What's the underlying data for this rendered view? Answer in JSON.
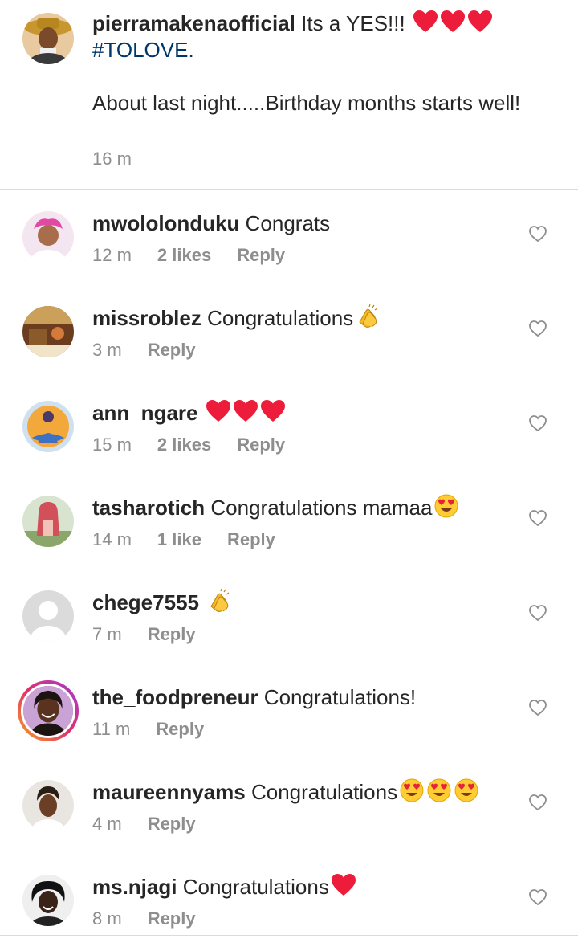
{
  "caption": {
    "username": "pierramakenaofficial",
    "text": "Its  a YES!!!",
    "emojis": [
      "red-heart-icon",
      "red-heart-icon",
      "red-heart-icon"
    ],
    "hashtag": "#TOLOVE.",
    "text2": "About last night.....Birthday months starts well!",
    "time": "16 m"
  },
  "comments": [
    {
      "username": "mwololonduku",
      "text": "Congrats",
      "emojis": [],
      "time": "12 m",
      "likes": "2 likes",
      "reply": "Reply"
    },
    {
      "username": "missroblez",
      "text": "Congratulations",
      "emojis": [
        "clapping-hands-icon"
      ],
      "time": "3 m",
      "likes": "",
      "reply": "Reply"
    },
    {
      "username": "ann_ngare",
      "text": "",
      "emojis": [
        "red-heart-icon",
        "red-heart-icon",
        "red-heart-icon"
      ],
      "time": "15 m",
      "likes": "2 likes",
      "reply": "Reply"
    },
    {
      "username": "tasharotich",
      "text": "Congratulations mamaa",
      "emojis": [
        "heart-eyes-face-icon"
      ],
      "time": "14 m",
      "likes": "1 like",
      "reply": "Reply"
    },
    {
      "username": "chege7555",
      "text": "",
      "emojis": [
        "clapping-hands-icon"
      ],
      "time": "7 m",
      "likes": "",
      "reply": "Reply"
    },
    {
      "username": "the_foodpreneur",
      "text": "Congratulations!",
      "emojis": [],
      "time": "11 m",
      "likes": "",
      "reply": "Reply"
    },
    {
      "username": "maureennyams",
      "text": "Congratulations",
      "emojis": [
        "heart-eyes-face-icon",
        "heart-eyes-face-icon",
        "heart-eyes-face-icon"
      ],
      "time": "4 m",
      "likes": "",
      "reply": "Reply"
    },
    {
      "username": "ms.njagi",
      "text": "Congratulations",
      "emojis": [
        "red-heart-icon"
      ],
      "time": "8 m",
      "likes": "",
      "reply": "Reply"
    }
  ],
  "colors": {
    "text": "#262626",
    "muted": "#8e8e8e",
    "hashtag": "#00376b",
    "heart": "#ed1c3a",
    "divider": "#dbdbdb"
  }
}
